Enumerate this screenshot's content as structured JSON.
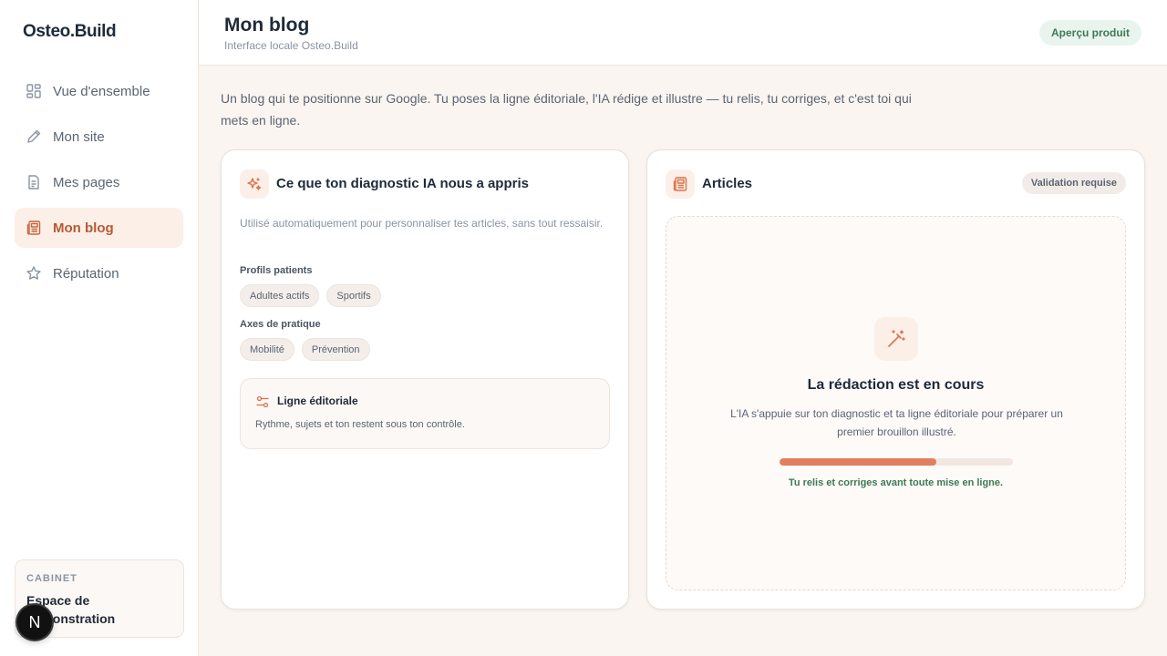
{
  "app": {
    "logo": "Osteo.Build"
  },
  "sidebar": {
    "items": [
      {
        "label": "Vue d'ensemble",
        "icon": "grid-icon",
        "active": false
      },
      {
        "label": "Mon site",
        "icon": "pencil-icon",
        "active": false
      },
      {
        "label": "Mes pages",
        "icon": "document-icon",
        "active": false
      },
      {
        "label": "Mon blog",
        "icon": "newspaper-icon",
        "active": true
      },
      {
        "label": "Réputation",
        "icon": "star-icon",
        "active": false
      }
    ],
    "cabinet": {
      "label": "CABINET",
      "name": "Espace de démonstration"
    },
    "badge": "N"
  },
  "header": {
    "title": "Mon blog",
    "subtitle": "Interface locale Osteo.Build",
    "badge": "Aperçu produit"
  },
  "intro": "Un blog qui te positionne sur Google. Tu poses la ligne éditoriale, l'IA rédige et illustre — tu relis, tu corriges, et c'est toi qui mets en ligne.",
  "diagnostic": {
    "title": "Ce que ton diagnostic IA nous a appris",
    "description": "Utilisé automatiquement pour personnaliser tes articles, sans tout ressaisir.",
    "groups": [
      {
        "label": "Profils patients",
        "chips": [
          "Adultes actifs",
          "Sportifs"
        ]
      },
      {
        "label": "Axes de pratique",
        "chips": [
          "Mobilité",
          "Prévention"
        ]
      }
    ],
    "ligne": {
      "title": "Ligne éditoriale",
      "description": "Rythme, sujets et ton restent sous ton contrôle."
    }
  },
  "articles": {
    "title": "Articles",
    "badge": "Validation requise",
    "draft": {
      "title": "La rédaction est en cours",
      "description": "L'IA s'appuie sur ton diagnostic et ta ligne éditoriale pour préparer un premier brouillon illustré.",
      "progress": 0.67,
      "note": "Tu relis et corriges avant toute mise en ligne."
    }
  },
  "colors": {
    "accent": "#e07f60",
    "accent_dark": "#b45a35",
    "success": "#3e7a56",
    "background": "#faf5f1"
  }
}
